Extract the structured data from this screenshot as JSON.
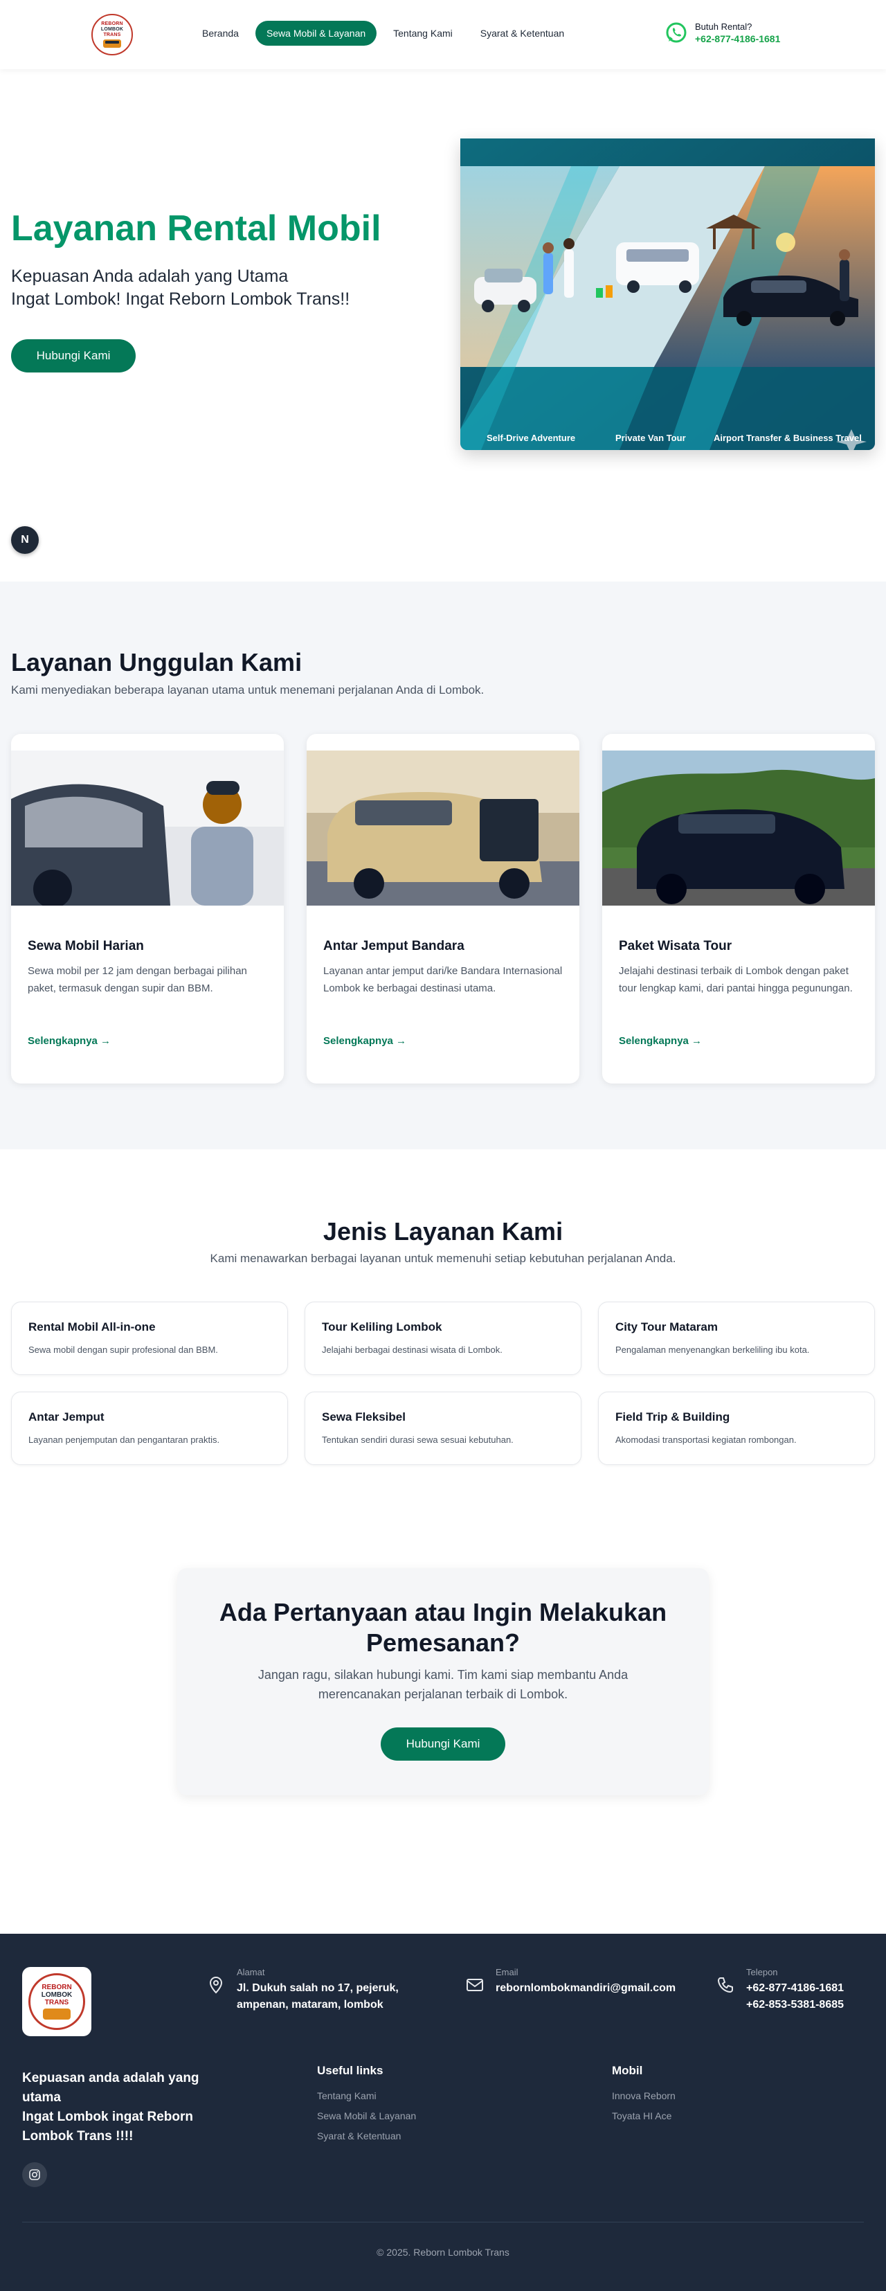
{
  "brand": {
    "logo_line1": "REBORN",
    "logo_line2": "LOMBOK",
    "logo_line3": "TRANS"
  },
  "nav": {
    "items": [
      {
        "label": "Beranda",
        "active": false
      },
      {
        "label": "Sewa Mobil & Layanan",
        "active": true
      },
      {
        "label": "Tentang Kami",
        "active": false
      },
      {
        "label": "Syarat & Ketentuan",
        "active": false
      }
    ],
    "contact_label": "Butuh Rental?",
    "contact_phone": "+62-877-4186-1681",
    "contact_icon": "whatsapp-icon"
  },
  "hero": {
    "title": "Layanan Rental Mobil",
    "subtitle_line1": "Kepuasan Anda adalah yang Utama",
    "subtitle_line2": "Ingat Lombok! Ingat Reborn Lombok Trans!!",
    "button": "Hubungi Kami",
    "banner_captions": [
      "Self-Drive Adventure",
      "Private Van Tour",
      "Airport Transfer & Business Travel"
    ]
  },
  "next_badge": "N",
  "services": {
    "title": "Layanan Unggulan Kami",
    "subtitle": "Kami menyediakan beberapa layanan utama untuk menemani perjalanan Anda di Lombok.",
    "cards": [
      {
        "title": "Sewa Mobil Harian",
        "desc": "Sewa mobil per 12 jam dengan berbagai pilihan paket, termasuk dengan supir dan BBM.",
        "link": "Selengkapnya →"
      },
      {
        "title": "Antar Jemput Bandara",
        "desc": "Layanan antar jemput dari/ke Bandara Internasional Lombok ke berbagai destinasi utama.",
        "link": "Selengkapnya →"
      },
      {
        "title": "Paket Wisata Tour",
        "desc": "Jelajahi destinasi terbaik di Lombok dengan paket tour lengkap kami, dari pantai hingga pegunungan.",
        "link": "Selengkapnya →"
      }
    ]
  },
  "types": {
    "title": "Jenis Layanan Kami",
    "subtitle": "Kami menawarkan berbagai layanan untuk memenuhi setiap kebutuhan perjalanan Anda.",
    "items": [
      {
        "title": "Rental Mobil All-in-one",
        "desc": "Sewa mobil dengan supir profesional dan BBM."
      },
      {
        "title": "Tour Keliling Lombok",
        "desc": "Jelajahi berbagai destinasi wisata di Lombok."
      },
      {
        "title": "City Tour Mataram",
        "desc": "Pengalaman menyenangkan berkeliling ibu kota."
      },
      {
        "title": "Antar Jemput",
        "desc": "Layanan penjemputan dan pengantaran praktis."
      },
      {
        "title": "Sewa Fleksibel",
        "desc": "Tentukan sendiri durasi sewa sesuai kebutuhan."
      },
      {
        "title": "Field Trip & Building",
        "desc": "Akomodasi transportasi kegiatan rombongan."
      }
    ]
  },
  "cta": {
    "title_line1": "Ada Pertanyaan atau Ingin Melakukan",
    "title_line2": "Pemesanan?",
    "text": "Jangan ragu, silakan hubungi kami. Tim kami siap membantu Anda merencanakan perjalanan terbaik di Lombok.",
    "button": "Hubungi Kami"
  },
  "footer": {
    "address_label": "Alamat",
    "address_line1": "Jl. Dukuh salah no 17, pejeruk,",
    "address_line2": "ampenan, mataram, lombok",
    "email_label": "Email",
    "email": "rebornlombokmandiri@gmail.com",
    "phone_label": "Telepon",
    "phone1": "+62-877-4186-1681",
    "phone2": "+62-853-5381-8685",
    "tagline_line1": "Kepuasan anda adalah yang",
    "tagline_line2": "utama",
    "tagline_line3": "Ingat Lombok ingat Reborn",
    "tagline_line4": "Lombok Trans !!!!",
    "useful_title": "Useful links",
    "useful_links": [
      "Tentang Kami",
      "Sewa Mobil & Layanan",
      "Syarat & Ketentuan"
    ],
    "mobil_title": "Mobil",
    "mobil_links": [
      "Innova Reborn",
      "Toyata HI Ace"
    ],
    "copyright": "© 2025. Reborn Lombok Trans"
  },
  "colors": {
    "brand_green": "#047857",
    "title_green": "#059669",
    "footer_bg": "#1e293b",
    "whatsapp": "#22c55e"
  }
}
